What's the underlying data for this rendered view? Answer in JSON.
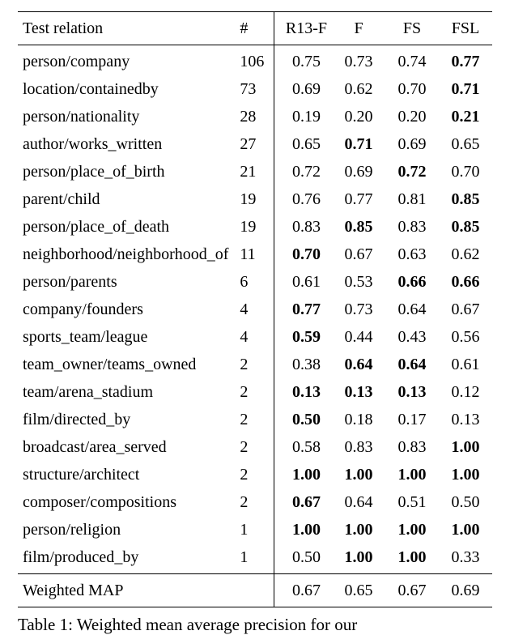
{
  "chart_data": {
    "type": "table",
    "title": "Weighted mean average precision",
    "columns": [
      "Test relation",
      "#",
      "R13-F",
      "F",
      "FS",
      "FSL"
    ],
    "rows": [
      {
        "relation": "person/company",
        "segments": [
          "person/company"
        ],
        "count": 106,
        "values": [
          0.75,
          0.73,
          0.74,
          0.77
        ],
        "bold_mask": [
          false,
          false,
          false,
          true
        ]
      },
      {
        "relation": "location/containedby",
        "segments": [
          "location/containedby"
        ],
        "count": 73,
        "values": [
          0.69,
          0.62,
          0.7,
          0.71
        ],
        "bold_mask": [
          false,
          false,
          false,
          true
        ]
      },
      {
        "relation": "person/nationality",
        "segments": [
          "person/nationality"
        ],
        "count": 28,
        "values": [
          0.19,
          0.2,
          0.2,
          0.21
        ],
        "bold_mask": [
          false,
          false,
          false,
          true
        ]
      },
      {
        "relation": "author/works_written",
        "segments": [
          "author/works",
          "written"
        ],
        "count": 27,
        "values": [
          0.65,
          0.71,
          0.69,
          0.65
        ],
        "bold_mask": [
          false,
          true,
          false,
          false
        ]
      },
      {
        "relation": "person/place_of_birth",
        "segments": [
          "person/place",
          "of",
          "birth"
        ],
        "count": 21,
        "values": [
          0.72,
          0.69,
          0.72,
          0.7
        ],
        "bold_mask": [
          false,
          false,
          true,
          false
        ]
      },
      {
        "relation": "parent/child",
        "segments": [
          "parent/child"
        ],
        "count": 19,
        "values": [
          0.76,
          0.77,
          0.81,
          0.85
        ],
        "bold_mask": [
          false,
          false,
          false,
          true
        ]
      },
      {
        "relation": "person/place_of_death",
        "segments": [
          "person/place",
          "of",
          "death"
        ],
        "count": 19,
        "values": [
          0.83,
          0.85,
          0.83,
          0.85
        ],
        "bold_mask": [
          false,
          true,
          false,
          true
        ]
      },
      {
        "relation": "neighborhood/neighborhood_of",
        "segments": [
          "neighborhood/neighborhood",
          "of"
        ],
        "count": 11,
        "values": [
          0.7,
          0.67,
          0.63,
          0.62
        ],
        "bold_mask": [
          true,
          false,
          false,
          false
        ]
      },
      {
        "relation": "person/parents",
        "segments": [
          "person/parents"
        ],
        "count": 6,
        "values": [
          0.61,
          0.53,
          0.66,
          0.66
        ],
        "bold_mask": [
          false,
          false,
          true,
          true
        ]
      },
      {
        "relation": "company/founders",
        "segments": [
          "company/founders"
        ],
        "count": 4,
        "values": [
          0.77,
          0.73,
          0.64,
          0.67
        ],
        "bold_mask": [
          true,
          false,
          false,
          false
        ]
      },
      {
        "relation": "sports_team/league",
        "segments": [
          "sports",
          "team/league"
        ],
        "count": 4,
        "values": [
          0.59,
          0.44,
          0.43,
          0.56
        ],
        "bold_mask": [
          true,
          false,
          false,
          false
        ]
      },
      {
        "relation": "team_owner/teams_owned",
        "segments": [
          "team",
          "owner/teams",
          "owned"
        ],
        "count": 2,
        "values": [
          0.38,
          0.64,
          0.64,
          0.61
        ],
        "bold_mask": [
          false,
          true,
          true,
          false
        ]
      },
      {
        "relation": "team/arena_stadium",
        "segments": [
          "team/arena",
          "stadium"
        ],
        "count": 2,
        "values": [
          0.13,
          0.13,
          0.13,
          0.12
        ],
        "bold_mask": [
          true,
          true,
          true,
          false
        ]
      },
      {
        "relation": "film/directed_by",
        "segments": [
          "film/directed",
          "by"
        ],
        "count": 2,
        "values": [
          0.5,
          0.18,
          0.17,
          0.13
        ],
        "bold_mask": [
          true,
          false,
          false,
          false
        ]
      },
      {
        "relation": "broadcast/area_served",
        "segments": [
          "broadcast/area",
          "served"
        ],
        "count": 2,
        "values": [
          0.58,
          0.83,
          0.83,
          1.0
        ],
        "bold_mask": [
          false,
          false,
          false,
          true
        ]
      },
      {
        "relation": "structure/architect",
        "segments": [
          "structure/architect"
        ],
        "count": 2,
        "values": [
          1.0,
          1.0,
          1.0,
          1.0
        ],
        "bold_mask": [
          true,
          true,
          true,
          true
        ]
      },
      {
        "relation": "composer/compositions",
        "segments": [
          "composer/compositions"
        ],
        "count": 2,
        "values": [
          0.67,
          0.64,
          0.51,
          0.5
        ],
        "bold_mask": [
          true,
          false,
          false,
          false
        ]
      },
      {
        "relation": "person/religion",
        "segments": [
          "person/religion"
        ],
        "count": 1,
        "values": [
          1.0,
          1.0,
          1.0,
          1.0
        ],
        "bold_mask": [
          true,
          true,
          true,
          true
        ]
      },
      {
        "relation": "film/produced_by",
        "segments": [
          "film/produced",
          "by"
        ],
        "count": 1,
        "values": [
          0.5,
          1.0,
          1.0,
          0.33
        ],
        "bold_mask": [
          false,
          true,
          true,
          false
        ]
      }
    ],
    "footer": {
      "label": "Weighted MAP",
      "values": [
        0.67,
        0.65,
        0.67,
        0.69
      ]
    }
  },
  "headers": {
    "relation": "Test relation",
    "count": "#",
    "c1": "R13-F",
    "c2": "F",
    "c3": "FS",
    "c4": "FSL"
  },
  "caption": "Table 1:  Weighted mean average precision for our"
}
